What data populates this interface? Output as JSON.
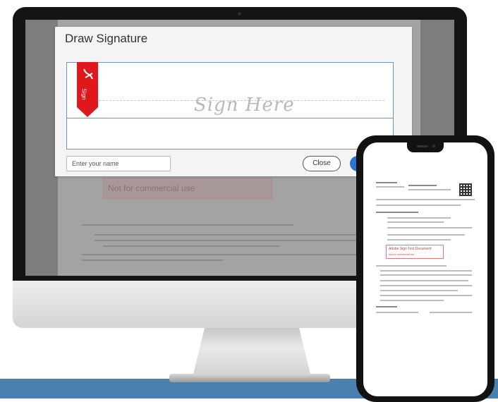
{
  "dialog": {
    "title": "Draw Signature",
    "sign_here": "Sign Here",
    "flag_label": "Sign",
    "name_placeholder": "Enter your name",
    "close_label": "Close"
  },
  "background_doc": {
    "watermark": "Not for commercial use"
  },
  "phone_doc": {
    "test_title": "Adobe Sign Test Document",
    "test_subtitle": "Not for commercial use"
  },
  "colors": {
    "accent": "#2c73d2",
    "flag": "#e0171d",
    "band": "#4a80b0"
  }
}
